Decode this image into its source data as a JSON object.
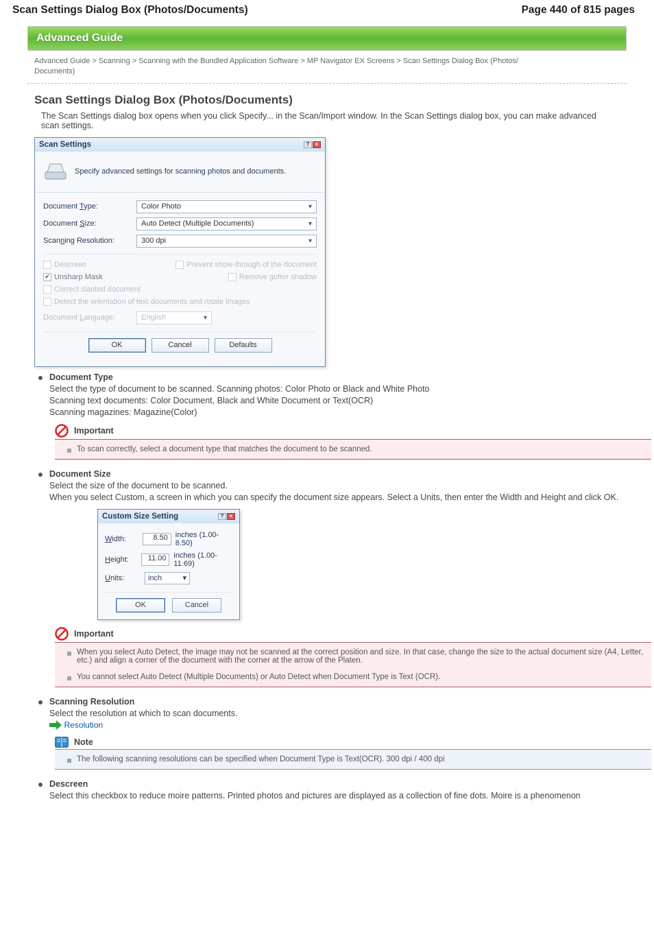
{
  "header": {
    "left": "Scan Settings Dialog Box (Photos/Documents)",
    "right": "Page 440 of 815 pages"
  },
  "banner": "Advanced Guide",
  "breadcrumbs": {
    "row1": "Advanced Guide > Scanning > Scanning with the Bundled Application Software > MP Navigator EX Screens > Scan Settings Dialog Box (Photos/",
    "row2": "Documents)"
  },
  "page_title": "Scan Settings Dialog Box (Photos/Documents)",
  "intro": "The Scan Settings dialog box opens when you click Specify... in the Scan/Import window. In the Scan Settings dialog box, you can make advanced scan settings.",
  "scan_dialog": {
    "title": "Scan Settings",
    "head_text": "Specify advanced settings for scanning photos and documents.",
    "doc_type": {
      "label_pre": "Document ",
      "label_u": "T",
      "label_post": "ype:",
      "value": "Color Photo"
    },
    "doc_size": {
      "label_pre": "Document ",
      "label_u": "S",
      "label_post": "ize:",
      "value": "Auto Detect (Multiple Documents)"
    },
    "resolution": {
      "label_pre": "Scan",
      "label_u": "n",
      "label_post": "ing Resolution:",
      "value": "300 dpi"
    },
    "chk_descreen": {
      "u": "D",
      "rest": "escreen"
    },
    "chk_prevent": {
      "pre": "Pre",
      "u": "v",
      "post": "ent show-through of the document"
    },
    "chk_unsharp": {
      "u": "U",
      "rest": "nsharp Mask"
    },
    "chk_remove": "Remove gutter shadow",
    "chk_correct": {
      "u": "C",
      "rest": "orrect slanted document"
    },
    "chk_detect": "Detect the orientation of text documents and rotate images",
    "doc_lang": {
      "label_pre": "Document ",
      "label_u": "L",
      "label_post": "anguage:",
      "value": "English"
    },
    "buttons": {
      "ok": "OK",
      "cancel": "Cancel",
      "defaults": "Defaults"
    }
  },
  "section_doc_type": {
    "title": "Document Type",
    "body1": "Select the type of document to be scanned. Scanning photos: Color Photo or Black and White Photo",
    "body2": "Scanning text documents: Color Document, Black and White Document or Text(OCR)",
    "body3": "Scanning magazines: Magazine(Color)",
    "important_title": "Important",
    "important_item": "To scan correctly, select a document type that matches the document to be scanned."
  },
  "section_doc_size": {
    "title": "Document Size",
    "body1": "Select the size of the document to be scanned.",
    "body2": "When you select Custom, a screen in which you can specify the document size appears. Select a Units, then enter the Width and Height and click OK."
  },
  "custom_dialog": {
    "title": "Custom Size Setting",
    "width": {
      "l": "Width:",
      "u": "W",
      "v": "8.50",
      "range": "inches (1.00-8.50)"
    },
    "height": {
      "l": "Height:",
      "u": "H",
      "v": "11.00",
      "range": "inches (1.00-11.69)"
    },
    "units": {
      "l": "Units:",
      "u": "U",
      "v": "inch"
    },
    "ok": "OK",
    "cancel": "Cancel"
  },
  "important2_title": "Important",
  "important2_items": [
    "When you select Auto Detect, the image may not be scanned at the correct position and size. In that case, change the size to the actual document size (A4, Letter, etc.) and align a corner of the document with the corner at the arrow of the Platen.",
    "You cannot select Auto Detect (Multiple Documents) or Auto Detect when Document Type is Text (OCR)."
  ],
  "section_resolution": {
    "title": "Scanning Resolution",
    "body": "Select the resolution at which to scan documents.",
    "link": "Resolution",
    "note_title": "Note",
    "note_item": "The following scanning resolutions can be specified when Document Type is Text(OCR). 300 dpi / 400 dpi"
  },
  "section_descreen": {
    "title": "Descreen",
    "body": "Select this checkbox to reduce moire patterns. Printed photos and pictures are displayed as a collection of fine dots. Moire is a phenomenon"
  }
}
